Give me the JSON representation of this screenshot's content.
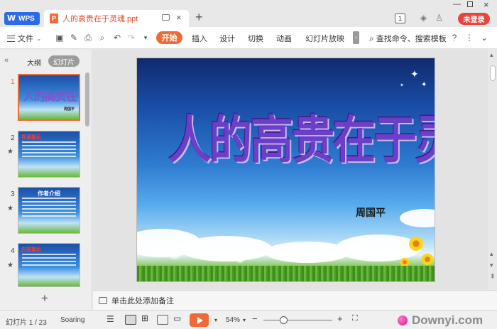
{
  "titlebar": {
    "app_tab": "WPS",
    "doc_tab_badge": "P",
    "doc_tab_name": "人的高贵在于灵魂.ppt",
    "new_tab": "+",
    "counter_badge": "1",
    "login_button": "未登录"
  },
  "toolbar": {
    "file_menu": "文件",
    "tabs": [
      "开始",
      "插入",
      "设计",
      "切换",
      "动画",
      "幻灯片放映"
    ],
    "active_tab": "开始",
    "search_command": "查找命令、搜索模板"
  },
  "left_panel": {
    "tab_outline": "大纲",
    "tab_slides": "幻灯片",
    "thumbnails": [
      {
        "number": "1",
        "title": "人的高贵在于灵魂",
        "subtitle": "周国平"
      },
      {
        "number": "2",
        "heading": "导读提示"
      },
      {
        "number": "3",
        "heading": "作者介绍"
      },
      {
        "number": "4",
        "heading": "内容提示"
      }
    ],
    "add_slide": "+"
  },
  "slide": {
    "title": "人的高贵在于灵魂",
    "author": "周国平"
  },
  "notes": {
    "placeholder": "单击此处添加备注"
  },
  "statusbar": {
    "slide_indicator": "幻灯片 1 / 23",
    "theme": "Soaring",
    "zoom": "54%",
    "zoom_minus": "−",
    "zoom_plus": "+"
  },
  "watermark": {
    "text": "Downyi.com"
  },
  "colors": {
    "accent": "#f06a35",
    "wps_blue": "#2b6be8",
    "login_red": "#e8443c",
    "title_purple": "#6b3fc7"
  }
}
